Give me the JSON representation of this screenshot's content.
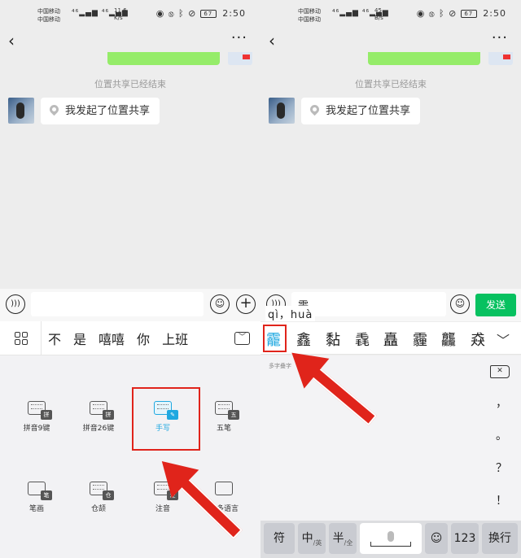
{
  "status": {
    "carrier1": "中国移动",
    "carrier2": "中国移动",
    "left_speed_value": "11.6",
    "left_speed_unit": "K/s",
    "right_speed_value": "45",
    "right_speed_unit": "B/s",
    "battery": "67",
    "time": "2:50"
  },
  "chat": {
    "system_msg": "位置共享已经结束",
    "bubble_text": "我发起了位置共享"
  },
  "left": {
    "input_value": "",
    "candidates": [
      "不",
      "是",
      "嘻嘻",
      "你",
      "上班"
    ],
    "input_methods": [
      {
        "label": "拼音9键",
        "badge": "拼"
      },
      {
        "label": "拼音26键",
        "badge": "拼"
      },
      {
        "label": "手写",
        "badge": ""
      },
      {
        "label": "五笔",
        "badge": "五"
      },
      {
        "label": "笔画",
        "badge": "笔"
      },
      {
        "label": "仓颉",
        "badge": "仓"
      },
      {
        "label": "注音",
        "badge": "注"
      },
      {
        "label": "更多语言",
        "badge": ""
      }
    ]
  },
  "right": {
    "input_value": "霅",
    "send_label": "发送",
    "pinyin": "qì，huà",
    "candidates": [
      "靇",
      "鑫",
      "黏",
      "毳",
      "矗",
      "霾",
      "龘",
      "猋"
    ],
    "hint": "多字叠字",
    "punctuation": [
      "，",
      "。",
      "？",
      "！"
    ],
    "keys": {
      "fu": "符",
      "zhong": "中",
      "zhong_sub": "/英",
      "ban": "半",
      "ban_sub": "/全",
      "num": "123",
      "switch": "换行"
    }
  }
}
